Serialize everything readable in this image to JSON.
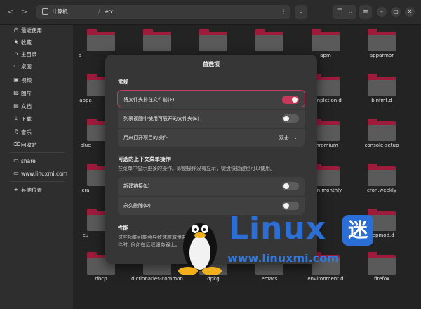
{
  "window": {
    "path": [
      "计算机",
      "etc"
    ],
    "path_separator": "/",
    "buttons": {
      "back": "<",
      "forward": ">",
      "path_menu": "⋮",
      "search": "⌕",
      "view_list": "☰",
      "view_options": "⌄",
      "menu": "≡",
      "minimize": "–",
      "maximize": "▢",
      "close": "✕"
    }
  },
  "sidebar": {
    "places": [
      {
        "label": "最近使用",
        "icon": "clock-icon",
        "glyph": "◷"
      },
      {
        "label": "收藏",
        "icon": "star-icon",
        "glyph": "★"
      },
      {
        "label": "主目录",
        "icon": "home-icon",
        "glyph": "⌂"
      },
      {
        "label": "桌面",
        "icon": "desktop-icon",
        "glyph": "▭"
      },
      {
        "label": "视频",
        "icon": "video-icon",
        "glyph": "▣"
      },
      {
        "label": "图片",
        "icon": "image-icon",
        "glyph": "▨"
      },
      {
        "label": "文档",
        "icon": "document-icon",
        "glyph": "▤"
      },
      {
        "label": "下载",
        "icon": "download-icon",
        "glyph": "⤓"
      },
      {
        "label": "音乐",
        "icon": "music-icon",
        "glyph": "♫"
      },
      {
        "label": "回收站",
        "icon": "trash-icon",
        "glyph": "⌫"
      }
    ],
    "network": [
      {
        "label": "share",
        "icon": "folder-icon",
        "glyph": "▭"
      },
      {
        "label": "www.linuxmi.com",
        "icon": "folder-icon",
        "glyph": "▭"
      }
    ],
    "other": {
      "label": "其他位置",
      "icon": "plus-icon",
      "glyph": "+"
    }
  },
  "files": {
    "visible_labels": [
      "apm",
      "apparmor",
      "completion.d",
      "binfmt.d",
      "chromium",
      "console-setup",
      "cron.monthly",
      "cron.weekly",
      "depmod.d",
      "dhcp",
      "dictionaries-common",
      "dpkg",
      "emacs",
      "environment.d",
      "firefox",
      "a",
      "appa",
      "blue",
      "cra",
      "cu"
    ]
  },
  "dialog": {
    "title": "首选项",
    "general": {
      "heading": "常规",
      "folders_first": {
        "label": "将文件夹排在文件前(F)",
        "on": true
      },
      "expandable_folders": {
        "label": "列表视图中使用可展开的文件夹(E)",
        "on": false
      },
      "open_action": {
        "label": "用来打开项目的操作",
        "value": "双击",
        "chevron": "⌄"
      }
    },
    "context_menu": {
      "heading": "可选的上下文菜单操作",
      "sub": "在菜单中显示更多的操作。即使操作没有显示，键盘快捷键也可以使用。",
      "create_link": {
        "label": "新建链接(L)",
        "on": false
      },
      "delete_permanently": {
        "label": "永久删除(D)",
        "on": false
      }
    },
    "performance": {
      "heading": "性能",
      "sub1": "这些功能可能会导致速度减慢并",
      "sub2": "件时, 例如在远程服务器上。"
    }
  },
  "watermark": {
    "word": "Linux",
    "mi": "迷",
    "url": "www.linuxmi.com",
    "brand_color": "#2b6fd6"
  }
}
